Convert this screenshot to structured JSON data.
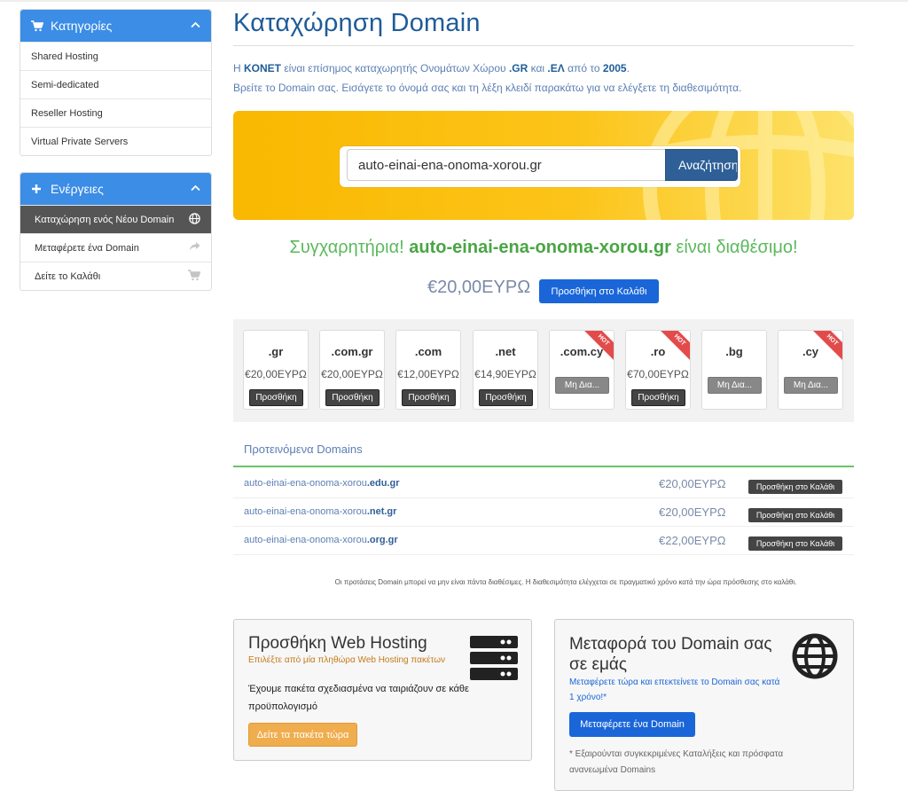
{
  "sidebar": {
    "categories": {
      "title": "Κατηγορίες",
      "items": [
        {
          "label": "Shared Hosting"
        },
        {
          "label": "Semi-dedicated"
        },
        {
          "label": "Reseller Hosting"
        },
        {
          "label": "Virtual Private Servers"
        }
      ]
    },
    "actions": {
      "title": "Ενέργειες",
      "items": [
        {
          "label": "Καταχώρηση ενός Νέου Domain",
          "icon": "globe-icon",
          "active": true
        },
        {
          "label": "Μεταφέρετε ένα Domain",
          "icon": "share-icon"
        },
        {
          "label": "Δείτε το Καλάθι",
          "icon": "cart-icon"
        }
      ]
    }
  },
  "page": {
    "title": "Καταχώρηση Domain",
    "intro": {
      "line1_a": "Η ",
      "line1_brand": "KONET",
      "line1_b": " είναι επίσημος καταχωρητής Ονομάτων Χώρου ",
      "line1_gr": ".GR",
      "line1_c": " και ",
      "line1_el": ".ΕΛ",
      "line1_d": " από το ",
      "line1_year": "2005",
      "line1_e": ".",
      "line2": "Βρείτε το Domain σας. Εισάγετε το όνομά σας και τη λέξη κλειδί παρακάτω για να ελέγξετε τη διαθεσιμότητα."
    }
  },
  "search": {
    "value": "auto-einai-ena-onoma-xorou.gr",
    "button": "Αναζήτηση"
  },
  "result": {
    "prefix": "Συγχαρητήρια! ",
    "domain": "auto-einai-ena-onoma-xorou.gr",
    "suffix": " είναι διαθέσιμο!",
    "price": "€20,00ΕΥΡΩ",
    "add_button": "Προσθήκη στο Καλάθι"
  },
  "tlds": [
    {
      "name": ".gr",
      "price": "€20,00ΕΥΡΩ",
      "button": "Προσθήκη",
      "hot": false,
      "available": true
    },
    {
      "name": ".com.gr",
      "price": "€20,00ΕΥΡΩ",
      "button": "Προσθήκη",
      "hot": false,
      "available": true
    },
    {
      "name": ".com",
      "price": "€12,00ΕΥΡΩ",
      "button": "Προσθήκη",
      "hot": false,
      "available": true
    },
    {
      "name": ".net",
      "price": "€14,90ΕΥΡΩ",
      "button": "Προσθήκη",
      "hot": false,
      "available": true
    },
    {
      "name": ".com.cy",
      "price": "",
      "button": "Μη Δια...",
      "hot": true,
      "available": false
    },
    {
      "name": ".ro",
      "price": "€70,00ΕΥΡΩ",
      "button": "Προσθήκη",
      "hot": true,
      "available": true
    },
    {
      "name": ".bg",
      "price": "",
      "button": "Μη Δια...",
      "hot": false,
      "available": false
    },
    {
      "name": ".cy",
      "price": "",
      "button": "Μη Δια...",
      "hot": true,
      "available": false
    }
  ],
  "hot_label": "HOT",
  "suggested": {
    "title": "Προτεινόμενα Domains",
    "rows": [
      {
        "base": "auto-einai-ena-onoma-xorou",
        "tld": ".edu.gr",
        "price": "€20,00ΕΥΡΩ",
        "button": "Προσθήκη στο Καλάθι"
      },
      {
        "base": "auto-einai-ena-onoma-xorou",
        "tld": ".net.gr",
        "price": "€20,00ΕΥΡΩ",
        "button": "Προσθήκη στο Καλάθι"
      },
      {
        "base": "auto-einai-ena-onoma-xorou",
        "tld": ".org.gr",
        "price": "€22,00ΕΥΡΩ",
        "button": "Προσθήκη στο Καλάθι"
      }
    ]
  },
  "note": "Οι προτάσεις Domain μπορεί να μην είναι πάντα διαθέσιμες. Η διαθεσιμότητα ελέγχεται σε πραγματικό χρόνο κατά την ώρα πρόσθεσης στο καλάθι.",
  "hosting_box": {
    "title": "Προσθήκη Web Hosting",
    "subtitle": "Επιλέξτε από μία πληθώρα Web Hosting πακέτων",
    "text": "Έχουμε πακέτα σχεδιασμένα να ταιριάζουν σε κάθε προϋπολογισμό",
    "button": "Δείτε τα πακέτα τώρα",
    "icon": "server-icon"
  },
  "transfer_box": {
    "title": "Μεταφορά του Domain σας σε εμάς",
    "subtitle": "Μεταφέρετε τώρα και επεκτείνετε το Domain σας κατά 1 χρόνο!*",
    "button": "Μεταφέρετε ένα Domain",
    "footnote": "* Εξαιρούνται συγκεκριμένες Καταλήξεις και πρόσφατα ανανεωμένα Domains",
    "icon": "globe-icon"
  },
  "colors": {
    "primary": "#3b8de6",
    "title_blue": "#1f5c99",
    "success_green": "#5cb85c",
    "hero_yellow": "#fcc419",
    "button_blue": "#1a66d8",
    "orange_button": "#f0ad4e"
  }
}
